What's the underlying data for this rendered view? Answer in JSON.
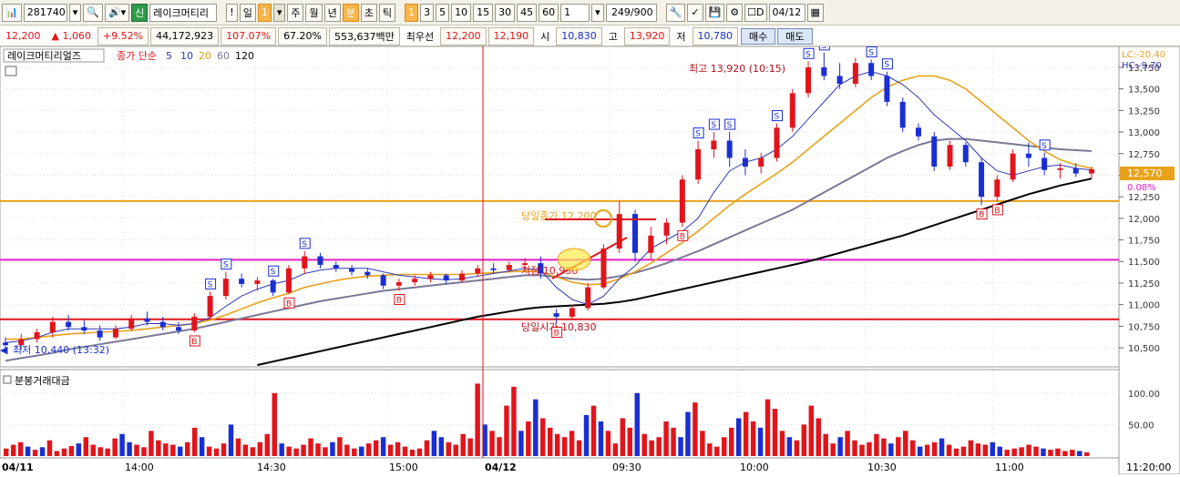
{
  "toolbar": {
    "code": "281740",
    "credit_badge": "신",
    "stock_name": "레이크머티리",
    "period_buttons": [
      "!",
      "일",
      "1",
      "주",
      "월",
      "년",
      "분",
      "초",
      "틱"
    ],
    "period_active": [
      "1",
      "분"
    ],
    "minute_buttons": [
      "1",
      "3",
      "5",
      "10",
      "15",
      "30",
      "45",
      "60"
    ],
    "minute_active": "1",
    "count_value": "1",
    "bar_count": "249/900",
    "d_label": "D",
    "date_value": "04/12"
  },
  "quote": {
    "price": "12,200",
    "change": "▲  1,060",
    "change_pct": "+9.52%",
    "volume": "44,172,923",
    "vol_ratio": "107.07%",
    "turnover": "67.20%",
    "amount": "553,637백만",
    "best_label": "최우선",
    "best_ask": "12,200",
    "best_bid": "12,190",
    "open_label": "시",
    "open": "10,830",
    "high_label": "고",
    "high": "13,920",
    "low_label": "저",
    "low": "10,780",
    "buy_button": "매수",
    "sell_button": "매도"
  },
  "chart_data": [
    {
      "type": "candlestick",
      "title": "레이크머티리얼즈",
      "legend": [
        {
          "label": "종가 단순",
          "color": "#e0151b"
        },
        {
          "label": "5",
          "color": "#2e38b8"
        },
        {
          "label": "10",
          "color": "#2e38b8"
        },
        {
          "label": "20",
          "color": "#e8a21a"
        },
        {
          "label": "60",
          "color": "#7a7895"
        },
        {
          "label": "120",
          "color": "#000000"
        }
      ],
      "y_ticks": [
        "13,750",
        "13,500",
        "13,250",
        "13,000",
        "12,750",
        "12,500",
        "12,250",
        "12,000",
        "11,750",
        "11,500",
        "11,250",
        "11,000",
        "10,750",
        "10,500"
      ],
      "ylim": [
        10300,
        13950
      ],
      "corner_lc": "LC:-20.40",
      "corner_hc": "HC:-9.70",
      "last_price_tag": "12,570",
      "last_change_tag": "0.08%",
      "annotations": {
        "high": "최고 13,920 (10:15)",
        "low": "최저 10,440 (13:32)",
        "prev_close": "당일종가 12,200",
        "open": "당일시가 10,830",
        "low_mark": "저점 10,930"
      },
      "horizontal_lines": [
        {
          "value": 12200,
          "color": "#e8a21a"
        },
        {
          "value": 11520,
          "color": "#e020c8"
        },
        {
          "value": 10830,
          "color": "#e0151b"
        }
      ],
      "markers": {
        "buy": "B",
        "sell": "S"
      },
      "candles": [
        {
          "o": 10560,
          "h": 10620,
          "l": 10460,
          "c": 10530
        },
        {
          "o": 10530,
          "h": 10660,
          "l": 10480,
          "c": 10600
        },
        {
          "o": 10600,
          "h": 10720,
          "l": 10560,
          "c": 10680
        },
        {
          "o": 10680,
          "h": 10860,
          "l": 10620,
          "c": 10800
        },
        {
          "o": 10800,
          "h": 10880,
          "l": 10700,
          "c": 10740
        },
        {
          "o": 10740,
          "h": 10820,
          "l": 10660,
          "c": 10700
        },
        {
          "o": 10700,
          "h": 10760,
          "l": 10580,
          "c": 10620
        },
        {
          "o": 10620,
          "h": 10760,
          "l": 10600,
          "c": 10720
        },
        {
          "o": 10720,
          "h": 10880,
          "l": 10700,
          "c": 10840
        },
        {
          "o": 10840,
          "h": 10920,
          "l": 10760,
          "c": 10800
        },
        {
          "o": 10800,
          "h": 10860,
          "l": 10700,
          "c": 10740
        },
        {
          "o": 10740,
          "h": 10800,
          "l": 10660,
          "c": 10700
        },
        {
          "o": 10700,
          "h": 10900,
          "l": 10680,
          "c": 10860
        },
        {
          "o": 10860,
          "h": 11150,
          "l": 10840,
          "c": 11100
        },
        {
          "o": 11100,
          "h": 11380,
          "l": 11060,
          "c": 11300
        },
        {
          "o": 11300,
          "h": 11360,
          "l": 11200,
          "c": 11240
        },
        {
          "o": 11240,
          "h": 11320,
          "l": 11160,
          "c": 11280
        },
        {
          "o": 11280,
          "h": 11300,
          "l": 11100,
          "c": 11140
        },
        {
          "o": 11140,
          "h": 11460,
          "l": 11120,
          "c": 11420
        },
        {
          "o": 11420,
          "h": 11620,
          "l": 11360,
          "c": 11560
        },
        {
          "o": 11560,
          "h": 11600,
          "l": 11420,
          "c": 11460
        },
        {
          "o": 11460,
          "h": 11500,
          "l": 11380,
          "c": 11420
        },
        {
          "o": 11420,
          "h": 11460,
          "l": 11340,
          "c": 11380
        },
        {
          "o": 11380,
          "h": 11420,
          "l": 11300,
          "c": 11340
        },
        {
          "o": 11340,
          "h": 11360,
          "l": 11180,
          "c": 11220
        },
        {
          "o": 11220,
          "h": 11300,
          "l": 11160,
          "c": 11260
        },
        {
          "o": 11260,
          "h": 11340,
          "l": 11220,
          "c": 11300
        },
        {
          "o": 11300,
          "h": 11380,
          "l": 11260,
          "c": 11340
        },
        {
          "o": 11340,
          "h": 11360,
          "l": 11240,
          "c": 11280
        },
        {
          "o": 11280,
          "h": 11400,
          "l": 11260,
          "c": 11360
        },
        {
          "o": 11360,
          "h": 11460,
          "l": 11320,
          "c": 11420
        },
        {
          "o": 11420,
          "h": 11480,
          "l": 11360,
          "c": 11400
        },
        {
          "o": 11400,
          "h": 11500,
          "l": 11380,
          "c": 11460
        },
        {
          "o": 11460,
          "h": 11540,
          "l": 11400,
          "c": 11480
        },
        {
          "o": 11480,
          "h": 11560,
          "l": 11300,
          "c": 11360
        },
        {
          "o": 10900,
          "h": 10950,
          "l": 10780,
          "c": 10860
        },
        {
          "o": 10860,
          "h": 11000,
          "l": 10820,
          "c": 10960
        },
        {
          "o": 10960,
          "h": 11250,
          "l": 10930,
          "c": 11200
        },
        {
          "o": 11200,
          "h": 11700,
          "l": 11180,
          "c": 11650
        },
        {
          "o": 11650,
          "h": 12200,
          "l": 11600,
          "c": 12050
        },
        {
          "o": 12050,
          "h": 12100,
          "l": 11500,
          "c": 11600
        },
        {
          "o": 11600,
          "h": 11900,
          "l": 11520,
          "c": 11800
        },
        {
          "o": 11800,
          "h": 12000,
          "l": 11700,
          "c": 11950
        },
        {
          "o": 11950,
          "h": 12500,
          "l": 11900,
          "c": 12450
        },
        {
          "o": 12450,
          "h": 12900,
          "l": 12400,
          "c": 12800
        },
        {
          "o": 12800,
          "h": 13000,
          "l": 12700,
          "c": 12900
        },
        {
          "o": 12900,
          "h": 13000,
          "l": 12600,
          "c": 12700
        },
        {
          "o": 12700,
          "h": 12800,
          "l": 12500,
          "c": 12600
        },
        {
          "o": 12600,
          "h": 12760,
          "l": 12520,
          "c": 12700
        },
        {
          "o": 12700,
          "h": 13100,
          "l": 12660,
          "c": 13050
        },
        {
          "o": 13050,
          "h": 13500,
          "l": 13000,
          "c": 13450
        },
        {
          "o": 13450,
          "h": 13820,
          "l": 13400,
          "c": 13750
        },
        {
          "o": 13750,
          "h": 13920,
          "l": 13600,
          "c": 13650
        },
        {
          "o": 13650,
          "h": 13800,
          "l": 13500,
          "c": 13560
        },
        {
          "o": 13560,
          "h": 13860,
          "l": 13520,
          "c": 13800
        },
        {
          "o": 13800,
          "h": 13840,
          "l": 13600,
          "c": 13650
        },
        {
          "o": 13650,
          "h": 13700,
          "l": 13300,
          "c": 13350
        },
        {
          "o": 13350,
          "h": 13400,
          "l": 13000,
          "c": 13050
        },
        {
          "o": 13050,
          "h": 13100,
          "l": 12900,
          "c": 12950
        },
        {
          "o": 12950,
          "h": 13000,
          "l": 12550,
          "c": 12600
        },
        {
          "o": 12600,
          "h": 12900,
          "l": 12560,
          "c": 12850
        },
        {
          "o": 12850,
          "h": 12880,
          "l": 12600,
          "c": 12650
        },
        {
          "o": 12650,
          "h": 12700,
          "l": 12150,
          "c": 12250
        },
        {
          "o": 12250,
          "h": 12500,
          "l": 12200,
          "c": 12450
        },
        {
          "o": 12450,
          "h": 12800,
          "l": 12420,
          "c": 12750
        },
        {
          "o": 12750,
          "h": 12880,
          "l": 12600,
          "c": 12700
        },
        {
          "o": 12700,
          "h": 12760,
          "l": 12500,
          "c": 12560
        },
        {
          "o": 12560,
          "h": 12640,
          "l": 12460,
          "c": 12580
        },
        {
          "o": 12580,
          "h": 12640,
          "l": 12480,
          "c": 12520
        },
        {
          "o": 12520,
          "h": 12600,
          "l": 12460,
          "c": 12570
        }
      ],
      "ma5": [
        10560,
        10580,
        10620,
        10680,
        10720,
        10720,
        10720,
        10720,
        10740,
        10780,
        10780,
        10760,
        10780,
        10850,
        10980,
        11100,
        11180,
        11240,
        11280,
        11360,
        11400,
        11420,
        11420,
        11420,
        11380,
        11340,
        11320,
        11300,
        11290,
        11300,
        11330,
        11360,
        11390,
        11420,
        11400,
        11200,
        11060,
        11000,
        11100,
        11300,
        11450,
        11650,
        11750,
        11850,
        12000,
        12300,
        12550,
        12650,
        12700,
        12800,
        12950,
        13150,
        13350,
        13550,
        13650,
        13700,
        13650,
        13550,
        13400,
        13200,
        13050,
        12900,
        12700,
        12550,
        12500,
        12550,
        12600,
        12620,
        12580,
        12560
      ],
      "ma20": [
        10600,
        10600,
        10620,
        10640,
        10660,
        10670,
        10680,
        10690,
        10700,
        10720,
        10740,
        10760,
        10780,
        10820,
        10880,
        10950,
        11020,
        11080,
        11130,
        11200,
        11240,
        11280,
        11310,
        11330,
        11340,
        11350,
        11350,
        11350,
        11350,
        11350,
        11360,
        11370,
        11380,
        11390,
        11380,
        11320,
        11260,
        11230,
        11240,
        11300,
        11380,
        11480,
        11600,
        11720,
        11850,
        12000,
        12150,
        12280,
        12400,
        12520,
        12650,
        12800,
        12950,
        13100,
        13250,
        13400,
        13520,
        13600,
        13650,
        13650,
        13600,
        13500,
        13350,
        13200,
        13050,
        12900,
        12780,
        12680,
        12620,
        12580
      ],
      "ma60": [
        10350,
        10380,
        10410,
        10440,
        10480,
        10510,
        10540,
        10570,
        10600,
        10630,
        10660,
        10690,
        10720,
        10760,
        10800,
        10840,
        10880,
        10920,
        10960,
        11000,
        11040,
        11070,
        11100,
        11130,
        11160,
        11180,
        11200,
        11220,
        11240,
        11260,
        11280,
        11300,
        11320,
        11340,
        11340,
        11320,
        11300,
        11290,
        11300,
        11330,
        11370,
        11420,
        11480,
        11550,
        11620,
        11700,
        11780,
        11860,
        11940,
        12020,
        12100,
        12200,
        12300,
        12400,
        12500,
        12600,
        12700,
        12780,
        12850,
        12900,
        12920,
        12920,
        12900,
        12880,
        12860,
        12840,
        12820,
        12800,
        12790,
        12780
      ],
      "ma120": [
        null,
        null,
        null,
        null,
        null,
        null,
        null,
        null,
        null,
        null,
        null,
        null,
        null,
        null,
        null,
        null,
        10300,
        10340,
        10380,
        10420,
        10460,
        10500,
        10540,
        10580,
        10620,
        10660,
        10700,
        10740,
        10780,
        10820,
        10860,
        10890,
        10920,
        10950,
        10970,
        10980,
        10990,
        11000,
        11010,
        11030,
        11060,
        11100,
        11140,
        11180,
        11220,
        11260,
        11300,
        11340,
        11380,
        11420,
        11460,
        11500,
        11550,
        11600,
        11650,
        11700,
        11750,
        11800,
        11860,
        11920,
        11980,
        12040,
        12100,
        12160,
        12220,
        12280,
        12330,
        12380,
        12420,
        12460
      ]
    },
    {
      "type": "bar",
      "title": "분봉거래대금",
      "y_ticks": [
        "100.00",
        "50.00"
      ],
      "ylim": [
        0,
        130
      ],
      "x_ticks": [
        "04/11",
        "14:00",
        "14:30",
        "15:00",
        "04/12",
        "09:30",
        "10:00",
        "10:30",
        "11:00",
        "11:20:00"
      ],
      "values": [
        12,
        18,
        22,
        15,
        10,
        14,
        25,
        8,
        12,
        16,
        20,
        30,
        18,
        14,
        12,
        28,
        35,
        22,
        18,
        14,
        40,
        25,
        20,
        18,
        15,
        22,
        45,
        30,
        15,
        12,
        20,
        50,
        28,
        18,
        14,
        22,
        35,
        100,
        20,
        15,
        12,
        18,
        28,
        20,
        14,
        22,
        30,
        18,
        12,
        15,
        20,
        25,
        30,
        18,
        22,
        15,
        10,
        12,
        25,
        40,
        30,
        22,
        18,
        35,
        28,
        115,
        50,
        40,
        30,
        80,
        110,
        40,
        55,
        90,
        60,
        45,
        35,
        30,
        40,
        25,
        65,
        80,
        55,
        40,
        20,
        60,
        45,
        100,
        35,
        25,
        30,
        55,
        45,
        30,
        70,
        85,
        40,
        20,
        15,
        30,
        45,
        60,
        70,
        55,
        45,
        90,
        75,
        40,
        30,
        25,
        50,
        80,
        60,
        35,
        20,
        30,
        40,
        25,
        18,
        22,
        35,
        28,
        20,
        30,
        40,
        25,
        15,
        18,
        22,
        28,
        18,
        12,
        15,
        25,
        20,
        18,
        22,
        15,
        10,
        12,
        14,
        18,
        15,
        12,
        10,
        12,
        8,
        10,
        8,
        6
      ]
    }
  ]
}
